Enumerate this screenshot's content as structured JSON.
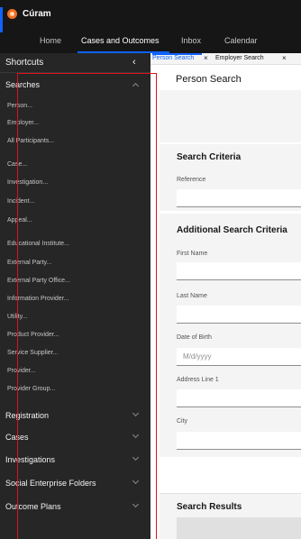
{
  "app": {
    "title": "Cúram"
  },
  "topnav": {
    "tabs": [
      "Home",
      "Cases and Outcomes",
      "Inbox",
      "Calendar"
    ],
    "active": "Cases and Outcomes"
  },
  "sidebar": {
    "title": "Shortcuts",
    "collapse_icon": "chevron-left-icon",
    "searches": {
      "label": "Searches",
      "expanded": true,
      "items": [
        "Person...",
        "Employer...",
        "All Participants...",
        "Case...",
        "Investigation...",
        "Incident...",
        "Appeal...",
        "Educational Institute...",
        "External Party...",
        "External Party Office...",
        "Information Provider...",
        "Utility...",
        "Product Provider...",
        "Service Supplier...",
        "Provider...",
        "Provider Group..."
      ]
    },
    "sections": [
      "Registration",
      "Cases",
      "Investigations",
      "Social Enterprise Folders",
      "Outcome Plans"
    ]
  },
  "content_tabs": [
    {
      "label": "Person Search",
      "close": "×",
      "active": true
    },
    {
      "label": "Employer Search",
      "close": "×",
      "active": false
    }
  ],
  "page": {
    "title": "Person Search",
    "criteria": {
      "title": "Search Criteria",
      "reference_label": "Reference"
    },
    "additional": {
      "title": "Additional Search Criteria",
      "first_name_label": "First Name",
      "last_name_label": "Last Name",
      "dob_label": "Date of Birth",
      "dob_placeholder": "M/d/yyyy",
      "address_label": "Address Line 1",
      "city_label": "City"
    },
    "results": {
      "title": "Search Results"
    }
  },
  "colors": {
    "accent": "#0f62fe",
    "topbar": "#161616",
    "sidebar": "#262626",
    "highlight_box": "#e0101d",
    "logo": "#f36d21"
  }
}
